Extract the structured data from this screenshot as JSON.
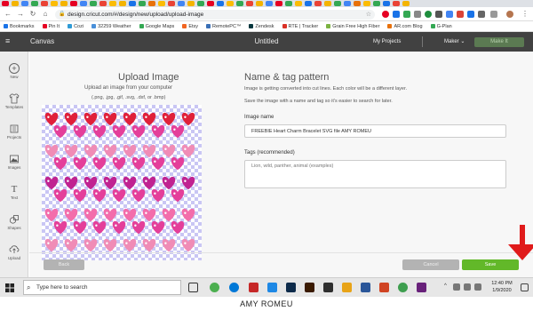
{
  "browser": {
    "url": "design.cricut.com/#/design/new/upload/upload-image",
    "bookmarks": [
      {
        "label": "Bookmarks",
        "color": "#1a73e8"
      },
      {
        "label": "Pin It",
        "color": "#e60023"
      },
      {
        "label": "Cozi",
        "color": "#2f9bd6"
      },
      {
        "label": "32259 Weather",
        "color": "#4a90d9"
      },
      {
        "label": "Google Maps",
        "color": "#34a853"
      },
      {
        "label": "Etsy",
        "color": "#f16521"
      },
      {
        "label": "RemotePC™",
        "color": "#3a6fb6"
      },
      {
        "label": "Zendesk",
        "color": "#03363d"
      },
      {
        "label": "RTE | Tracker",
        "color": "#d93025"
      },
      {
        "label": "Grain Free High Fiber",
        "color": "#7cb342"
      },
      {
        "label": "AR.com Blog",
        "color": "#e8710a"
      },
      {
        "label": "G-Plan",
        "color": "#34a853"
      }
    ]
  },
  "app": {
    "canvas_label": "Canvas",
    "doc_title": "Untitled",
    "my_projects": "My Projects",
    "machine": "Maker",
    "make_it": "Make It"
  },
  "sidebar": {
    "items": [
      {
        "label": "New",
        "icon": "plus-icon"
      },
      {
        "label": "Templates",
        "icon": "shirt-icon"
      },
      {
        "label": "Projects",
        "icon": "projects-icon"
      },
      {
        "label": "Images",
        "icon": "images-icon"
      },
      {
        "label": "Text",
        "icon": "text-icon"
      },
      {
        "label": "Shapes",
        "icon": "shapes-icon"
      },
      {
        "label": "Upload",
        "icon": "upload-icon"
      }
    ]
  },
  "upload": {
    "title": "Upload Image",
    "subtitle": "Upload an image from your computer",
    "formats": "(.png, .jpg, .gif, .svg, .dxf, or .bmp)",
    "heart_colors": [
      "#e0203a",
      "#e43f9a",
      "#f08cb6",
      "#c02391",
      "#f36dab"
    ]
  },
  "naming": {
    "title": "Name & tag pattern",
    "desc1": "Image is getting converted into cut lines. Each color will be a different layer.",
    "desc2": "Save the image with a name and tag so it's easier to search for later.",
    "image_name_label": "Image name",
    "image_name_value": "FREEBIE Heart Charm Bracelet SVG file AMY ROMEU",
    "tags_label": "Tags (recommended)",
    "tags_placeholder": "Lion, wild, panther, animal (examples)"
  },
  "buttons": {
    "back": "Back",
    "cancel": "Cancel",
    "save": "Save"
  },
  "taskbar": {
    "search_placeholder": "Type here to search",
    "time": "12:40 PM",
    "date": "1/9/2020"
  },
  "watermark": "AMY ROMEU"
}
